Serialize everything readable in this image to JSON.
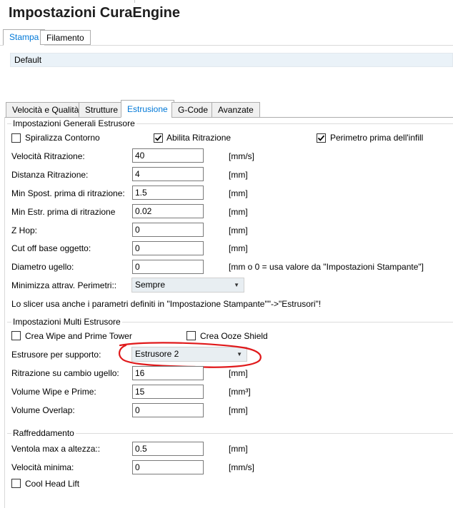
{
  "window": {
    "title": "Impostazioni CuraEngine"
  },
  "top_tabs": [
    {
      "label": "Stampa",
      "active": true
    },
    {
      "label": "Filamento",
      "active": false
    }
  ],
  "profile": {
    "selected": "Default"
  },
  "sub_tabs": [
    {
      "label": "Velocità e Qualità",
      "active": false
    },
    {
      "label": "Strutture",
      "active": false
    },
    {
      "label": "Estrusione",
      "active": true
    },
    {
      "label": "G-Code",
      "active": false
    },
    {
      "label": "Avanzate",
      "active": false
    }
  ],
  "general_extruder": {
    "title": "Impostazioni Generali Estrusore",
    "spiralize": {
      "label": "Spiralizza Contorno",
      "checked": false
    },
    "enable_retraction": {
      "label": "Abilita Ritrazione",
      "checked": true
    },
    "perimeter_before_infill": {
      "label": "Perimetro prima dell'infill",
      "checked": true
    },
    "retraction_speed": {
      "label": "Velocità Ritrazione:",
      "value": "40",
      "unit": "[mm/s]"
    },
    "retraction_distance": {
      "label": "Distanza Ritrazione:",
      "value": "4",
      "unit": "[mm]"
    },
    "min_travel": {
      "label": "Min Spost. prima di ritrazione:",
      "value": "1.5",
      "unit": "[mm]"
    },
    "min_extrusion": {
      "label": "Min Estr. prima di ritrazione",
      "value": "0.02",
      "unit": "[mm]"
    },
    "z_hop": {
      "label": "Z Hop:",
      "value": "0",
      "unit": "[mm]"
    },
    "cut_off": {
      "label": "Cut off base oggetto:",
      "value": "0",
      "unit": "[mm]"
    },
    "nozzle_diameter": {
      "label": "Diametro ugello:",
      "value": "0",
      "unit": "[mm o 0 = usa valore da \"Impostazioni Stampante\"]"
    },
    "minimize_travel": {
      "label": "Minimizza attrav. Perimetri::",
      "value": "Sempre"
    },
    "note": "Lo slicer usa anche i parametri definiti in \"Impostazione Stampante\"\"->\"Estrusori\"!"
  },
  "multi_extruder": {
    "title": "Impostazioni Multi Estrusore",
    "wipe_tower": {
      "label": "Crea Wipe and Prime Tower",
      "checked": false
    },
    "ooze_shield": {
      "label": "Crea Ooze Shield",
      "checked": false
    },
    "support_extruder": {
      "label": "Estrusore per supporto:",
      "value": "Estrusore 2"
    },
    "nozzle_switch_retraction": {
      "label": "Ritrazione su cambio ugello:",
      "value": "16",
      "unit": "[mm]"
    },
    "wipe_prime_volume": {
      "label": "Volume Wipe e Prime:",
      "value": "15",
      "unit": "[mm³]"
    },
    "volume_overlap": {
      "label": "Volume Overlap:",
      "value": "0",
      "unit": "[mm]"
    }
  },
  "cooling": {
    "title": "Raffreddamento",
    "max_fan_height": {
      "label": "Ventola max a altezza::",
      "value": "0.5",
      "unit": "[mm]"
    },
    "min_speed": {
      "label": "Velocità minima:",
      "value": "0",
      "unit": "[mm/s]"
    },
    "cool_head_lift": {
      "label": "Cool Head Lift",
      "checked": false
    }
  },
  "colors": {
    "accent": "#0078d7",
    "annotation": "#e0191b",
    "profile_bg": "#eaf2f8",
    "select_bg": "#e8eef2"
  }
}
